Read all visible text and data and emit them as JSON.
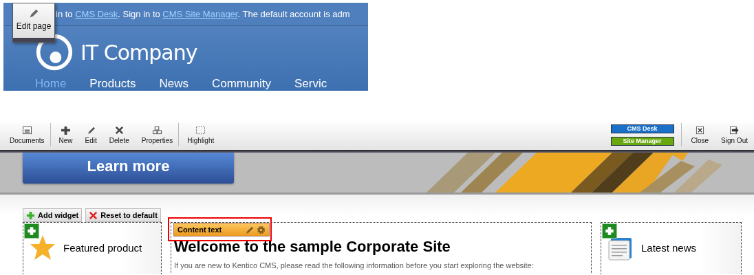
{
  "site_preview": {
    "signin_bar": {
      "lead": "in to ",
      "link_1": "CMS Desk",
      "middle": ". Sign in to ",
      "link_2": "CMS Site Manager",
      "tail": ". The default account is adm"
    },
    "edit_page_button": {
      "label": "Edit page"
    },
    "logo": {
      "text": "IT Company"
    },
    "nav": [
      {
        "label": "Home",
        "selected": true
      },
      {
        "label": "Products",
        "selected": false
      },
      {
        "label": "News",
        "selected": false
      },
      {
        "label": "Community",
        "selected": false
      },
      {
        "label": "Servic",
        "selected": false
      }
    ]
  },
  "toolbar": {
    "left": [
      {
        "label": "Documents"
      },
      {
        "label": "New"
      },
      {
        "label": "Edit"
      },
      {
        "label": "Delete"
      },
      {
        "label": "Properties"
      },
      {
        "label": "Highlight"
      }
    ],
    "switch": [
      {
        "label": "CMS Desk",
        "color": "#1a6fc9"
      },
      {
        "label": "Site Manager",
        "color": "#6aa80f"
      }
    ],
    "right": [
      {
        "label": "Close"
      },
      {
        "label": "Sign Out"
      }
    ]
  },
  "banner": {
    "button": "Learn more"
  },
  "zone_actions": [
    "Add widget",
    "Reset to default"
  ],
  "widgets": {
    "left": {
      "title": "Featured product"
    },
    "main": {
      "header": "Content text",
      "heading": "Welcome to the sample Corporate Site",
      "text": "If you are new to Kentico CMS, please read the following information before you start exploring the website:"
    },
    "right": {
      "title": "Latest news"
    }
  }
}
